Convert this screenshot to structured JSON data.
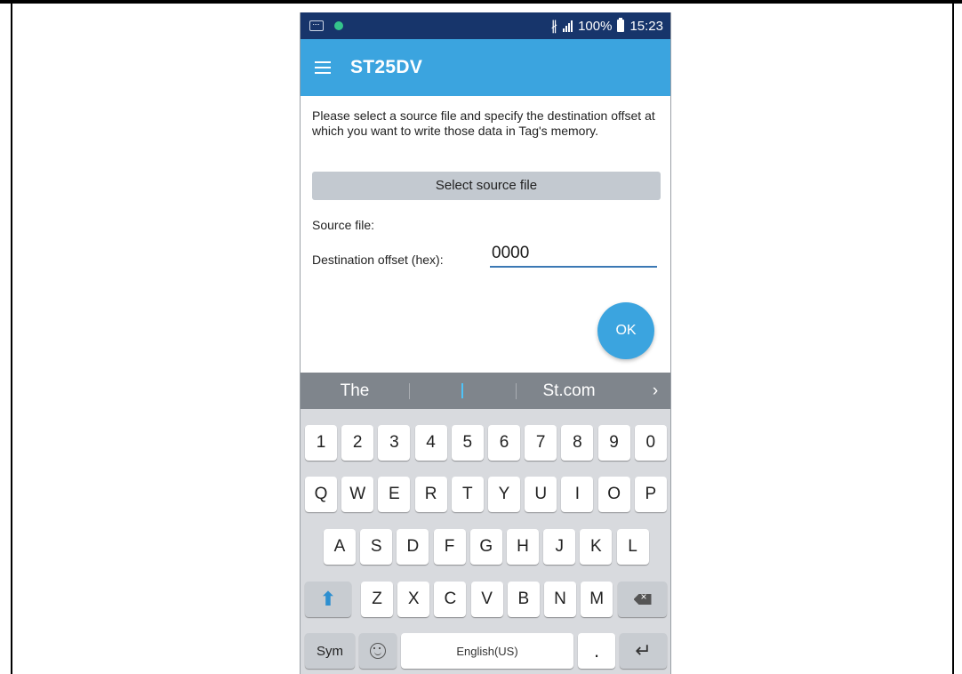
{
  "status_bar": {
    "battery": "100%",
    "time": "15:23"
  },
  "app_bar": {
    "title": "ST25DV"
  },
  "screen": {
    "instructions": "Please select a source file and specify the destination offset at which you want to write those data in Tag's memory.",
    "select_button_label": "Select source file",
    "source_file_label": "Source file:",
    "destination_offset_label": "Destination offset (hex):",
    "destination_offset_value": "0000",
    "ok_button_label": "OK"
  },
  "suggestion_bar": {
    "items": [
      "The",
      "St.com"
    ],
    "more_glyph": "›"
  },
  "keyboard": {
    "row_numbers": [
      "1",
      "2",
      "3",
      "4",
      "5",
      "6",
      "7",
      "8",
      "9",
      "0"
    ],
    "row_top": [
      "Q",
      "W",
      "E",
      "R",
      "T",
      "Y",
      "U",
      "I",
      "O",
      "P"
    ],
    "row_middle": [
      "A",
      "S",
      "D",
      "F",
      "G",
      "H",
      "J",
      "K",
      "L"
    ],
    "row_bottom": [
      "Z",
      "X",
      "C",
      "V",
      "B",
      "N",
      "M"
    ],
    "sym_label": "Sym",
    "space_label": "English(US)",
    "period_label": "."
  },
  "colors": {
    "status_bar": "#17356b",
    "app_bar": "#3ba4df",
    "ok_button": "#3ba4df",
    "input_underline": "#3b78b4",
    "suggestion_bar": "#7f858c",
    "keyboard_bg": "#d8dade"
  },
  "icons": {
    "menu": "hamburger-icon",
    "bluetooth": "bluetooth-icon",
    "signal": "signal-icon",
    "battery": "battery-icon",
    "shift": "shift-icon",
    "backspace": "backspace-icon",
    "emoji": "emoji-icon",
    "enter": "enter-icon"
  }
}
